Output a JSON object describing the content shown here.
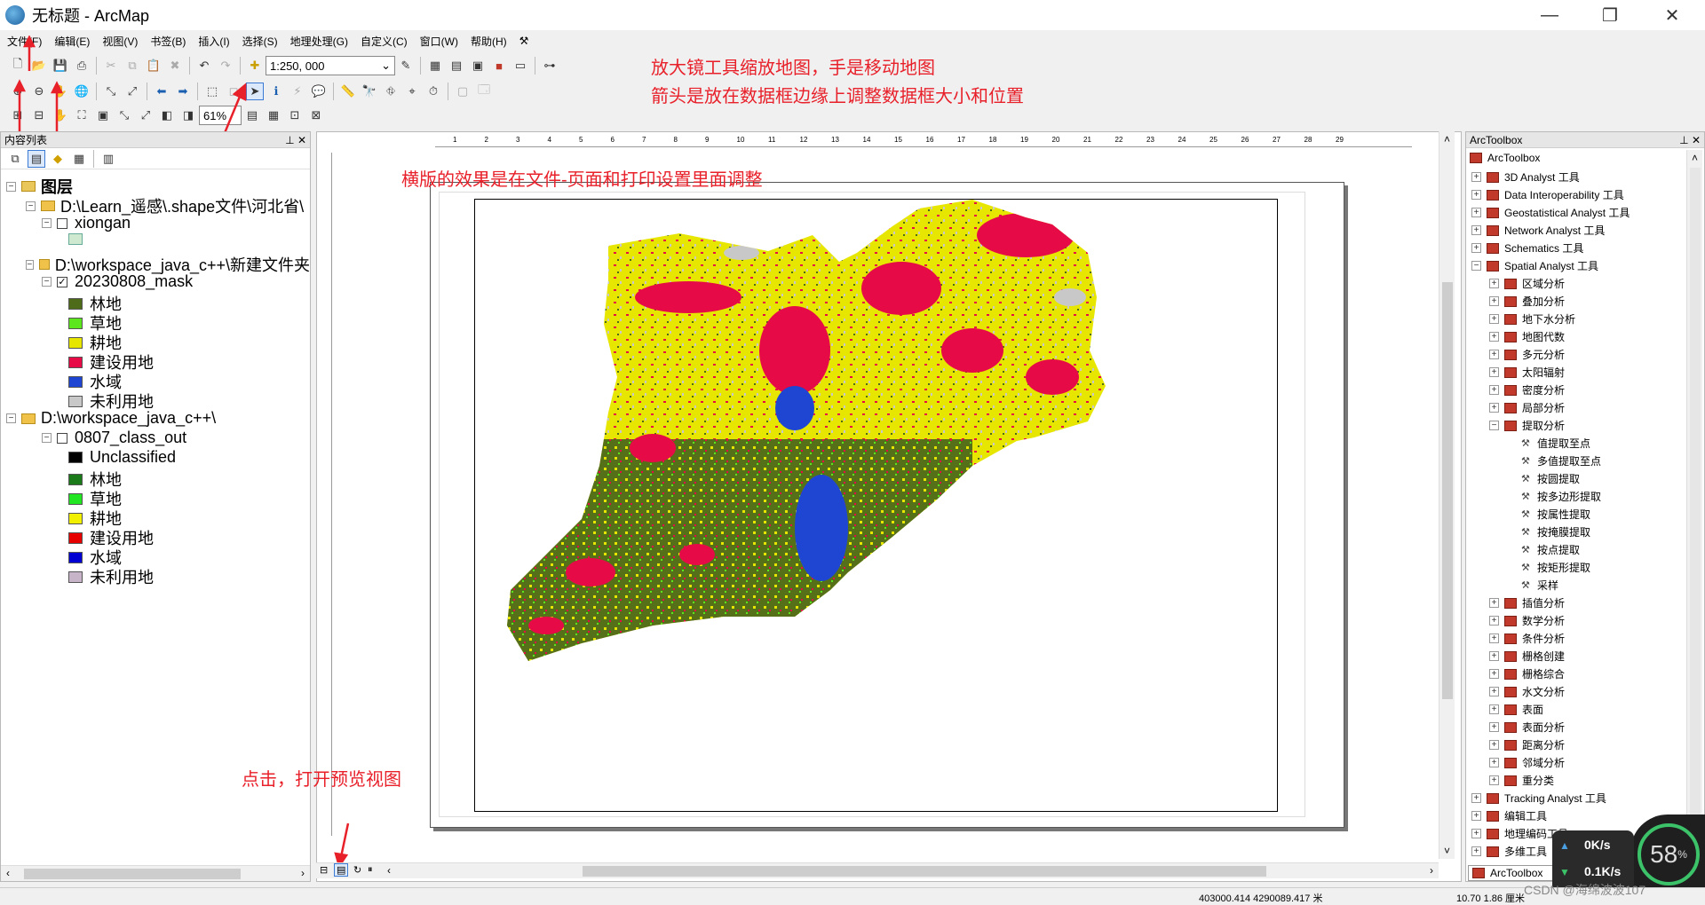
{
  "window": {
    "title": "无标题 - ArcMap",
    "min": "—",
    "max": "❐",
    "close": "✕"
  },
  "menu": [
    "文件(F)",
    "编辑(E)",
    "视图(V)",
    "书签(B)",
    "插入(I)",
    "选择(S)",
    "地理处理(G)",
    "自定义(C)",
    "窗口(W)",
    "帮助(H)"
  ],
  "toolbar": {
    "scale": "1:250, 000",
    "zoom": "61%"
  },
  "annotations": {
    "a1": "放大镜工具缩放地图，手是移动地图",
    "a2": "箭头是放在数据框边缘上调整数据框大小和位置",
    "a3": "横版的效果是在文件-页面和打印设置里面调整",
    "a4": "点击，打开预览视图"
  },
  "toc": {
    "header": "内容列表",
    "root": "图层",
    "group1": {
      "path": "D:\\Learn_遥感\\.shape文件\\河北省\\",
      "layer": "xiongan"
    },
    "group2": {
      "path": "D:\\workspace_java_c++\\新建文件夹",
      "layer": "20230808_mask",
      "classes": [
        {
          "label": "林地",
          "color": "#4e6b1a"
        },
        {
          "label": "草地",
          "color": "#5ce61e"
        },
        {
          "label": "耕地",
          "color": "#e6e600"
        },
        {
          "label": "建设用地",
          "color": "#e60a46"
        },
        {
          "label": "水域",
          "color": "#1e46d2"
        },
        {
          "label": "未利用地",
          "color": "#c8c8c8"
        }
      ]
    },
    "group3": {
      "path": "D:\\workspace_java_c++\\",
      "layer": "0807_class_out",
      "classes": [
        {
          "label": "Unclassified",
          "color": "#000000"
        },
        {
          "label": "林地",
          "color": "#1a7a1a"
        },
        {
          "label": "草地",
          "color": "#22e622"
        },
        {
          "label": "耕地",
          "color": "#f0f000"
        },
        {
          "label": "建设用地",
          "color": "#e60000"
        },
        {
          "label": "水域",
          "color": "#0000d2"
        },
        {
          "label": "未利用地",
          "color": "#c8b4c8"
        }
      ]
    }
  },
  "ruler_h": [
    "1",
    "2",
    "3",
    "4",
    "5",
    "6",
    "7",
    "8",
    "9",
    "10",
    "11",
    "12",
    "13",
    "14",
    "15",
    "16",
    "17",
    "18",
    "19",
    "20",
    "21",
    "22",
    "23",
    "24",
    "25",
    "26",
    "27",
    "28",
    "29"
  ],
  "toolbox": {
    "header": "ArcToolbox",
    "root": "ArcToolbox",
    "toolsets": [
      "3D Analyst 工具",
      "Data Interoperability 工具",
      "Geostatistical Analyst 工具",
      "Network Analyst 工具",
      "Schematics 工具",
      "Spatial Analyst 工具"
    ],
    "spatial": [
      "区域分析",
      "叠加分析",
      "地下水分析",
      "地图代数",
      "多元分析",
      "太阳辐射",
      "密度分析",
      "局部分析",
      "提取分析"
    ],
    "extract_tools": [
      "值提取至点",
      "多值提取至点",
      "按圆提取",
      "按多边形提取",
      "按属性提取",
      "按掩膜提取",
      "按点提取",
      "按矩形提取",
      "采样"
    ],
    "spatial_more": [
      "插值分析",
      "数学分析",
      "条件分析",
      "栅格创建",
      "栅格综合",
      "水文分析",
      "表面",
      "表面分析",
      "距离分析",
      "邻域分析",
      "重分类"
    ],
    "tail": [
      "Tracking Analyst 工具",
      "编辑工具",
      "地理编码工具",
      "多维工具"
    ],
    "tab": "ArcToolbox"
  },
  "status": {
    "coords": "403000.414  4290089.417 米",
    "page": "10.70  1.86 厘米",
    "watermark": "CSDN @海绵波波107"
  },
  "speed": {
    "up": "0K/s",
    "down": "0.1K/s",
    "pct": "58",
    "unit": "%"
  }
}
